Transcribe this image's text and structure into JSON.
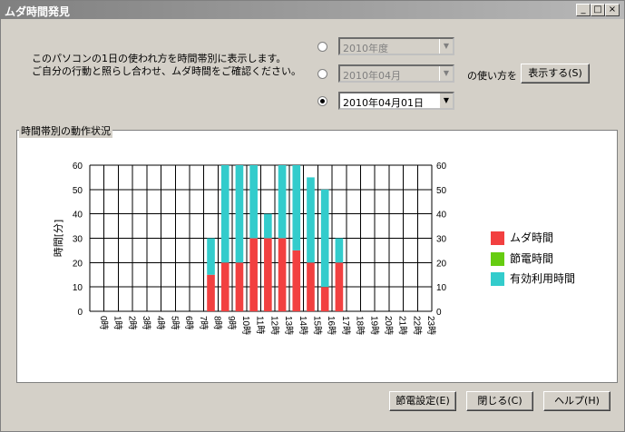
{
  "window": {
    "title": "ムダ時間発見"
  },
  "description": {
    "line1": "このパソコンの1日の使われ方を時間帯別に表示します。",
    "line2": "ご自分の行動と照らし合わせ、ムダ時間をご確認ください。"
  },
  "period": {
    "year_value": "2010年度",
    "month_value": "2010年04月",
    "day_value": "2010年04月01日",
    "suffix_label": "の使い方を",
    "show_button": "表示する(S)"
  },
  "group_title": "時間帯別の動作状況",
  "buttons": {
    "power": "節電設定(E)",
    "close": "閉じる(C)",
    "help": "ヘルプ(H)"
  },
  "colors": {
    "muda": "#f24040",
    "setsuden": "#66cc11",
    "yuko": "#33cccc"
  },
  "chart_data": {
    "type": "bar",
    "stacked": true,
    "ylabel": "時間[分]",
    "ylim": [
      0,
      60
    ],
    "yticks": [
      0,
      10,
      20,
      30,
      40,
      50,
      60
    ],
    "grid": true,
    "legend_position": "right",
    "categories": [
      "0時",
      "1時",
      "2時",
      "3時",
      "4時",
      "5時",
      "6時",
      "7時",
      "8時",
      "9時",
      "10時",
      "11時",
      "12時",
      "13時",
      "14時",
      "15時",
      "16時",
      "17時",
      "18時",
      "19時",
      "20時",
      "21時",
      "22時",
      "23時"
    ],
    "series": [
      {
        "name": "ムダ時間",
        "color": "#f24040",
        "values": [
          0,
          0,
          0,
          0,
          0,
          0,
          0,
          0,
          15,
          20,
          20,
          30,
          30,
          30,
          25,
          20,
          10,
          20,
          0,
          0,
          0,
          0,
          0,
          0
        ]
      },
      {
        "name": "節電時間",
        "color": "#66cc11",
        "values": [
          0,
          0,
          0,
          0,
          0,
          0,
          0,
          0,
          0,
          0,
          0,
          0,
          0,
          0,
          0,
          0,
          0,
          0,
          0,
          0,
          0,
          0,
          0,
          0
        ]
      },
      {
        "name": "有効利用時間",
        "color": "#33cccc",
        "values": [
          0,
          0,
          0,
          0,
          0,
          0,
          0,
          0,
          15,
          40,
          40,
          30,
          10,
          30,
          35,
          35,
          40,
          10,
          0,
          0,
          0,
          0,
          0,
          0
        ]
      }
    ]
  }
}
